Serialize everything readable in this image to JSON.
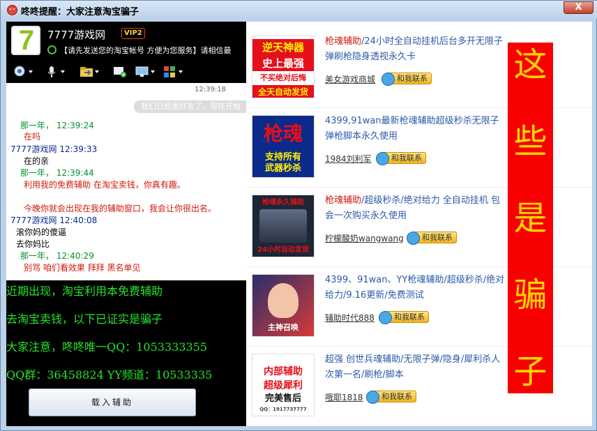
{
  "window": {
    "title": "咚咚提醒：大家注意淘宝骗子",
    "close_label": "X"
  },
  "contact": {
    "logo_text": "7",
    "name": "7777游戏网",
    "vip": "VIP2",
    "signature": "【请先发送您的淘宝帐号 方便为您服务】请相信最"
  },
  "chat": {
    "time": "12:39:18",
    "bubble": "我们已经是好友了，现在开始",
    "messages": [
      {
        "text": "那一年，  12:39:24",
        "cls": "hdr-green"
      },
      {
        "text": "在吗",
        "cls": "body-red"
      },
      {
        "text": "7777游戏网   12:39:33",
        "cls": "hdr-blue"
      },
      {
        "text": "在的亲",
        "cls": "body-black"
      },
      {
        "text": "那一年，  12:39:44",
        "cls": "hdr-green"
      },
      {
        "text": "利用我的免费辅助  在淘宝卖钱，你真有趣。",
        "cls": "body-red"
      },
      {
        "text": "今晚你就会出现在我的辅助窗口，我会让你很出名。",
        "cls": "body-red"
      },
      {
        "text": "7777游戏网   12:40:08",
        "cls": "hdr-blue"
      },
      {
        "text": "滚你妈的傻逼",
        "cls": "body-black"
      },
      {
        "text": "去你妈比",
        "cls": "body-black"
      },
      {
        "text": "那一年，  12:40:29",
        "cls": "hdr-green"
      },
      {
        "text": "别骂  咱们看效果  拜拜  黑名单见",
        "cls": "body-red"
      }
    ]
  },
  "notice": {
    "lines": [
      "近期出现，淘宝利用本免费辅助",
      "去淘宝卖钱，以下已证实是骗子",
      "大家注意，咚咚唯一QQ：1053333355",
      "QQ群：36458824 YY频道：10533335"
    ],
    "button_label": "载入辅助"
  },
  "listings": [
    {
      "thumb_lines": [
        "逆天神器",
        "史上最强",
        "不买绝对后悔",
        "全天自动发货"
      ],
      "title_hl": "枪魂辅助",
      "title_rest": "/24小时全自动挂机后台多开无限子弹刷枪隐身透视永久卡",
      "seller": "美女游戏商城",
      "contact": "和我联系"
    },
    {
      "thumb_lines": [
        "枪魂",
        "支持所有",
        "武器秒杀"
      ],
      "title_hl": "",
      "title_rest": "4399,91wan最新枪魂辅助超级秒杀无限子弹枪脚本永久使用",
      "seller": "1984刘利军",
      "contact": "和我联系"
    },
    {
      "thumb_lines": [
        "枪魂永久辅助",
        "24小时自动发货"
      ],
      "title_hl": "枪魂辅助",
      "title_rest": "/超级秒杀/绝对给力 全自动挂机 包会一次购买永久使用",
      "seller": "柠檬酸奶wangwang",
      "contact": "和我联系"
    },
    {
      "thumb_lines": [
        "主神召唤"
      ],
      "title_hl": "",
      "title_rest": "4399、91wan、YY枪魂辅助/超级秒杀/绝对给力/9.16更新/免费测试",
      "seller": "辅助时代888",
      "contact": "和我联系"
    },
    {
      "thumb_lines": [
        "内部辅助",
        "超级犀利",
        "完美售后",
        "QQ：1917737777"
      ],
      "title_hl": "",
      "title_rest": "超强 创世兵魂辅助/无限子弹/隐身/犀利杀人次第一名/刷枪/脚本",
      "seller": "哦耶1818",
      "contact": "和我联系"
    }
  ],
  "warning": {
    "chars": [
      "这",
      "些",
      "是",
      "骗",
      "子"
    ]
  },
  "colors": {
    "warning_bg": "#f80000",
    "warning_text": "#ffd600",
    "notice_text": "#25e32a"
  }
}
